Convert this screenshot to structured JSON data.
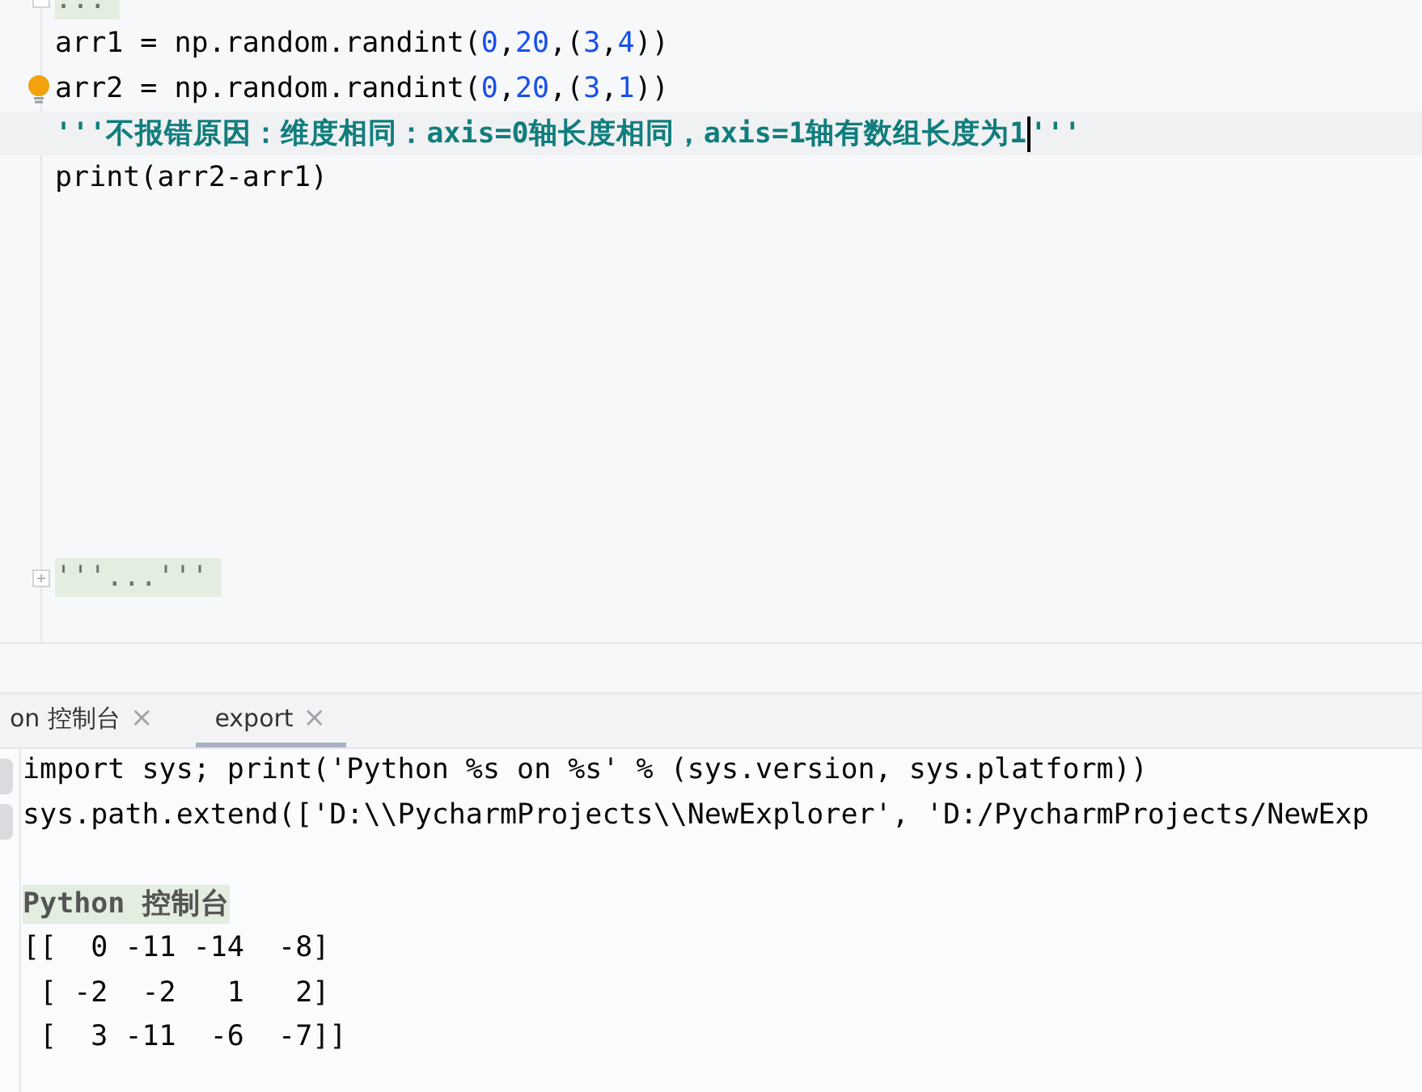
{
  "editor": {
    "lines": [
      {
        "kind": "folded",
        "expandable": false,
        "text": "..."
      },
      {
        "kind": "code",
        "tokens": [
          {
            "kind": "plain",
            "text": "arr1 = np.random.randint("
          },
          {
            "kind": "number",
            "text": "0"
          },
          {
            "kind": "plain",
            "text": ","
          },
          {
            "kind": "number",
            "text": "20"
          },
          {
            "kind": "plain",
            "text": ",("
          },
          {
            "kind": "number",
            "text": "3"
          },
          {
            "kind": "plain",
            "text": ","
          },
          {
            "kind": "number",
            "text": "4"
          },
          {
            "kind": "plain",
            "text": "))"
          }
        ]
      },
      {
        "kind": "code",
        "bulb": true,
        "tokens": [
          {
            "kind": "plain",
            "text": "arr2 = np.random.randint("
          },
          {
            "kind": "number",
            "text": "0"
          },
          {
            "kind": "plain",
            "text": ","
          },
          {
            "kind": "number",
            "text": "20"
          },
          {
            "kind": "plain",
            "text": ",("
          },
          {
            "kind": "number",
            "text": "3"
          },
          {
            "kind": "plain",
            "text": ","
          },
          {
            "kind": "number",
            "text": "1"
          },
          {
            "kind": "plain",
            "text": "))"
          }
        ]
      },
      {
        "kind": "docstring",
        "current": true,
        "text": "'''不报错原因：维度相同：axis=0轴长度相同，axis=1轴有数组长度为1",
        "tail": "'''"
      },
      {
        "kind": "code",
        "tokens": [
          {
            "kind": "plain",
            "text": "print(arr2-arr1)"
          }
        ]
      },
      {
        "kind": "blank"
      },
      {
        "kind": "blank"
      },
      {
        "kind": "blank"
      },
      {
        "kind": "blank"
      },
      {
        "kind": "blank"
      },
      {
        "kind": "blank"
      },
      {
        "kind": "blank"
      },
      {
        "kind": "blank"
      },
      {
        "kind": "folded",
        "expandable": true,
        "text": "'''...'''"
      }
    ]
  },
  "console": {
    "tabs": [
      {
        "label": "on 控制台",
        "selected": false,
        "close": "×"
      },
      {
        "label": "export",
        "selected": true,
        "close": "×"
      }
    ],
    "lines": [
      {
        "kind": "text",
        "text": "import sys; print('Python %s on %s' % (sys.version, sys.platform))"
      },
      {
        "kind": "text",
        "text": "sys.path.extend(['D:\\\\PycharmProjects\\\\NewExplorer', 'D:/PycharmProjects/NewExp"
      },
      {
        "kind": "blank"
      },
      {
        "kind": "banner",
        "text": "Python 控制台"
      },
      {
        "kind": "text",
        "text": "[[  0 -11 -14  -8]"
      },
      {
        "kind": "text",
        "text": " [ -2  -2   1   2]"
      },
      {
        "kind": "text",
        "text": " [  3 -11  -6  -7]]"
      }
    ]
  }
}
